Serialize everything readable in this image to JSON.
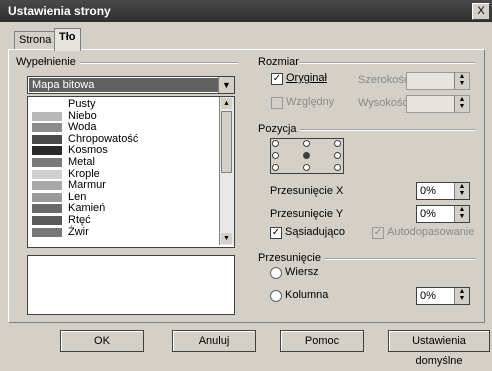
{
  "window": {
    "title": "Ustawienia strony",
    "close_glyph": "X"
  },
  "tabs": [
    {
      "label": "Strona"
    },
    {
      "label": "Tło"
    }
  ],
  "fill": {
    "section_label": "Wypełnienie",
    "type_value": "Mapa bitowa",
    "items": [
      {
        "label": "Pusty",
        "swatch": "#ffffff"
      },
      {
        "label": "Niebo",
        "swatch": "#b8b8b8"
      },
      {
        "label": "Woda",
        "swatch": "#8c8c8c"
      },
      {
        "label": "Chropowatość",
        "swatch": "#4a4a4a"
      },
      {
        "label": "Kosmos",
        "swatch": "#2a2a2a"
      },
      {
        "label": "Metal",
        "swatch": "#7a7a7a"
      },
      {
        "label": "Krople",
        "swatch": "#cfcfcf"
      },
      {
        "label": "Marmur",
        "swatch": "#a8a8a8"
      },
      {
        "label": "Len",
        "swatch": "#9a9a9a"
      },
      {
        "label": "Kamień",
        "swatch": "#6a6a6a"
      },
      {
        "label": "Rtęć",
        "swatch": "#5a5a5a"
      },
      {
        "label": "Żwir",
        "swatch": "#777777"
      }
    ]
  },
  "size": {
    "section_label": "Rozmiar",
    "original_label": "Oryginał",
    "original_checked": true,
    "relative_label": "Względny",
    "width_label": "Szerokość",
    "height_label": "Wysokość"
  },
  "position": {
    "section_label": "Pozycja",
    "offset_x_label": "Przesunięcie X",
    "offset_x_value": "0%",
    "offset_y_label": "Przesunięcie Y",
    "offset_y_value": "0%",
    "tile_label": "Sąsiadująco",
    "tile_checked": true,
    "autofit_label": "Autodopasowanie",
    "autofit_checked": true
  },
  "offset": {
    "section_label": "Przesunięcie",
    "row_label": "Wiersz",
    "column_label": "Kolumna",
    "value": "0%"
  },
  "buttons": {
    "ok": "OK",
    "cancel": "Anuluj",
    "help": "Pomoc",
    "defaults": "Ustawienia domyślne"
  }
}
